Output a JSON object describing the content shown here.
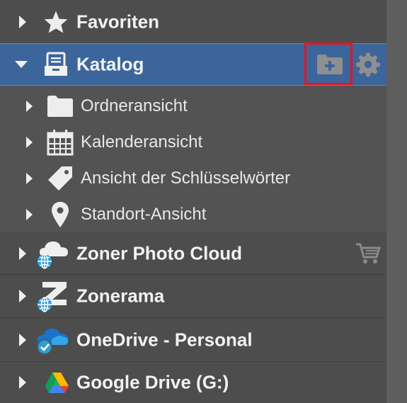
{
  "tree": {
    "favorites": {
      "label": "Favoriten",
      "icon": "star-icon"
    },
    "catalog": {
      "label": "Katalog",
      "icon": "catalog-icon",
      "actions": {
        "add_folder": "folder-plus-icon",
        "settings": "gear-icon"
      },
      "children": [
        {
          "label": "Ordneransicht",
          "icon": "folder-icon"
        },
        {
          "label": "Kalenderansicht",
          "icon": "calendar-icon"
        },
        {
          "label": "Ansicht der Schlüsselwörter",
          "icon": "tag-icon"
        },
        {
          "label": "Standort-Ansicht",
          "icon": "map-pin-icon"
        }
      ]
    },
    "cloud": {
      "label": "Zoner Photo Cloud",
      "icon": "cloud-globe-icon",
      "action": "cart-icon"
    },
    "zonerama": {
      "label": "Zonerama",
      "icon": "zonerama-globe-icon"
    },
    "onedrive": {
      "label": "OneDrive - Personal",
      "icon": "onedrive-icon"
    },
    "gdrive": {
      "label": "Google Drive (G:)",
      "icon": "google-drive-icon"
    }
  },
  "colors": {
    "selected": "#3c659c",
    "highlight_box": "#e8131d",
    "panel": "#535353"
  }
}
